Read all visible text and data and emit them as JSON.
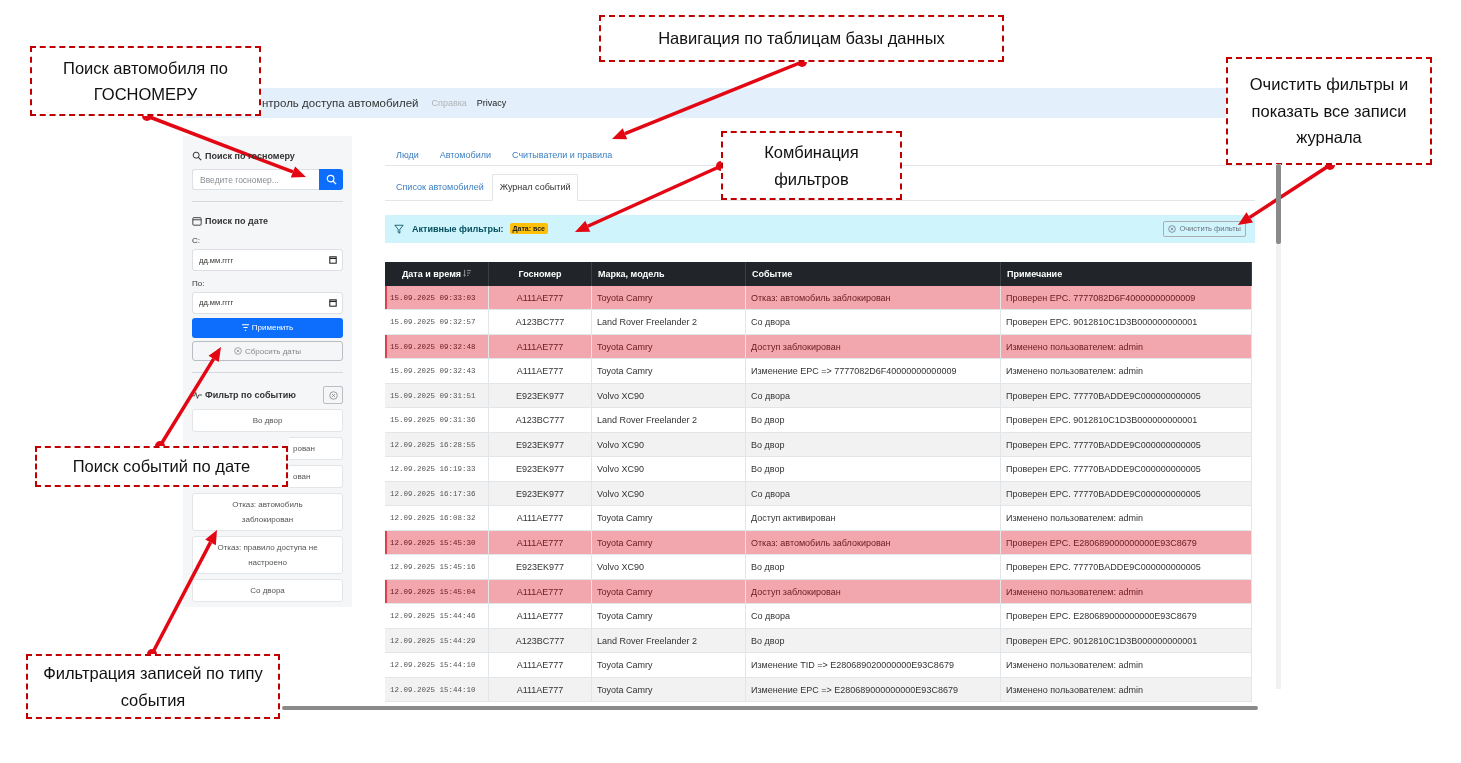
{
  "app": {
    "brand": "нтроль доступа автомобилей",
    "nav_links": [
      {
        "label": "Справка",
        "disabled": true
      },
      {
        "label": "Privacy",
        "disabled": false
      }
    ]
  },
  "sidebar": {
    "plate_search": {
      "title": "Поиск по госномеру",
      "placeholder": "Введите госномер..."
    },
    "date_search": {
      "title": "Поиск по дате",
      "from_label": "С:",
      "from_placeholder": "дд.мм.гггг",
      "to_label": "По:",
      "to_placeholder": "дд.мм.гггг",
      "apply_button": "Применить",
      "reset_button": "Сбросить даты"
    },
    "event_filter": {
      "title": "Фильтр по событию",
      "options": [
        "Во двор",
        "рован",
        "ован",
        "Отказ: автомобиль заблокирован",
        "Отказ: правило доступа не настроено",
        "Со двора"
      ]
    }
  },
  "tabs": [
    {
      "label": "Люди",
      "selected": false
    },
    {
      "label": "Автомобили",
      "selected": false
    },
    {
      "label": "Считыватели и правила",
      "selected": false
    }
  ],
  "subtabs": [
    {
      "label": "Список автомобилей",
      "selected": false
    },
    {
      "label": "Журнал событий",
      "selected": true
    }
  ],
  "filter_bar": {
    "label": "Активные фильтры:",
    "badges": [
      "Дата: все"
    ],
    "clear_button": "Очистить фильты"
  },
  "table": {
    "columns": [
      "Дата и время",
      "Госномер",
      "Марка, модель",
      "Событие",
      "Примечание"
    ],
    "rows": [
      {
        "cells": [
          "15.09.2025 09:33:03",
          "A111AE777",
          "Toyota Camry",
          "Отказ: автомобиль заблокирован",
          "Проверен EPC. 7777082D6F40000000000009"
        ],
        "highlighted": true
      },
      {
        "cells": [
          "15.09.2025 09:32:57",
          "A123BC777",
          "Land Rover Freelander 2",
          "Со двора",
          "Проверен EPC. 9012810C1D3B000000000001"
        ],
        "highlighted": false
      },
      {
        "cells": [
          "15.09.2025 09:32:48",
          "A111AE777",
          "Toyota Camry",
          "Доступ заблокирован",
          "Изменено пользователем: admin"
        ],
        "highlighted": true
      },
      {
        "cells": [
          "15.09.2025 09:32:43",
          "A111AE777",
          "Toyota Camry",
          "Изменение EPC => 7777082D6F40000000000009",
          "Изменено пользователем: admin"
        ],
        "highlighted": false
      },
      {
        "cells": [
          "15.09.2025 09:31:51",
          "E923EK977",
          "Volvo XC90",
          "Со двора",
          "Проверен EPC. 77770BADDE9C000000000005"
        ],
        "highlighted": false
      },
      {
        "cells": [
          "15.09.2025 09:31:36",
          "A123BC777",
          "Land Rover Freelander 2",
          "Во двор",
          "Проверен EPC. 9012810C1D3B000000000001"
        ],
        "highlighted": false
      },
      {
        "cells": [
          "12.09.2025 16:28:55",
          "E923EK977",
          "Volvo XC90",
          "Во двор",
          "Проверен EPC. 77770BADDE9C000000000005"
        ],
        "highlighted": false
      },
      {
        "cells": [
          "12.09.2025 16:19:33",
          "E923EK977",
          "Volvo XC90",
          "Во двор",
          "Проверен EPC. 77770BADDE9C000000000005"
        ],
        "highlighted": false
      },
      {
        "cells": [
          "12.09.2025 16:17:36",
          "E923EK977",
          "Volvo XC90",
          "Со двора",
          "Проверен EPC. 77770BADDE9C000000000005"
        ],
        "highlighted": false
      },
      {
        "cells": [
          "12.09.2025 16:08:32",
          "A111AE777",
          "Toyota Camry",
          "Доступ активирован",
          "Изменено пользователем: admin"
        ],
        "highlighted": false
      },
      {
        "cells": [
          "12.09.2025 15:45:30",
          "A111AE777",
          "Toyota Camry",
          "Отказ: автомобиль заблокирован",
          "Проверен EPC. E280689000000000E93C8679"
        ],
        "highlighted": true
      },
      {
        "cells": [
          "12.09.2025 15:45:16",
          "E923EK977",
          "Volvo XC90",
          "Во двор",
          "Проверен EPC. 77770BADDE9C000000000005"
        ],
        "highlighted": false
      },
      {
        "cells": [
          "12.09.2025 15:45:04",
          "A111AE777",
          "Toyota Camry",
          "Доступ заблокирован",
          "Изменено пользователем: admin"
        ],
        "highlighted": true
      },
      {
        "cells": [
          "12.09.2025 15:44:46",
          "A111AE777",
          "Toyota Camry",
          "Со двора",
          "Проверен EPC. E280689000000000E93C8679"
        ],
        "highlighted": false
      },
      {
        "cells": [
          "12.09.2025 15:44:29",
          "A123BC777",
          "Land Rover Freelander 2",
          "Во двор",
          "Проверен EPC. 9012810C1D3B000000000001"
        ],
        "highlighted": false
      },
      {
        "cells": [
          "12.09.2025 15:44:10",
          "A111AE777",
          "Toyota Camry",
          "Изменение TID => E280689020000000E93C8679",
          "Изменено пользователем: admin"
        ],
        "highlighted": false
      },
      {
        "cells": [
          "12.09.2025 15:44:10",
          "A111AE777",
          "Toyota Camry",
          "Изменение EPC => E280689000000000E93C8679",
          "Изменено пользователем: admin"
        ],
        "highlighted": false
      }
    ]
  },
  "callouts": [
    {
      "text": "Поиск автомобиля по ГОСНОМЕРУ"
    },
    {
      "text": "Навигация по таблицам базы данных"
    },
    {
      "text": "Очистить фильтры и показать все записи журнала"
    },
    {
      "text": "Комбинация фильтров"
    },
    {
      "text": "Поиск событий по дате"
    },
    {
      "text": "Фильтрация записей по типу события"
    }
  ]
}
